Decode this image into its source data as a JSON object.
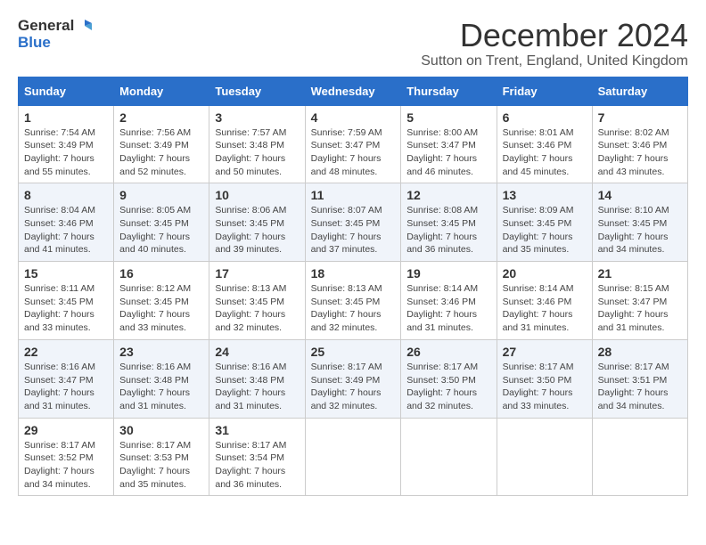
{
  "logo": {
    "general": "General",
    "blue": "Blue"
  },
  "title": "December 2024",
  "location": "Sutton on Trent, England, United Kingdom",
  "days_of_week": [
    "Sunday",
    "Monday",
    "Tuesday",
    "Wednesday",
    "Thursday",
    "Friday",
    "Saturday"
  ],
  "weeks": [
    [
      {
        "day": "1",
        "sunrise": "7:54 AM",
        "sunset": "3:49 PM",
        "daylight": "7 hours and 55 minutes."
      },
      {
        "day": "2",
        "sunrise": "7:56 AM",
        "sunset": "3:49 PM",
        "daylight": "7 hours and 52 minutes."
      },
      {
        "day": "3",
        "sunrise": "7:57 AM",
        "sunset": "3:48 PM",
        "daylight": "7 hours and 50 minutes."
      },
      {
        "day": "4",
        "sunrise": "7:59 AM",
        "sunset": "3:47 PM",
        "daylight": "7 hours and 48 minutes."
      },
      {
        "day": "5",
        "sunrise": "8:00 AM",
        "sunset": "3:47 PM",
        "daylight": "7 hours and 46 minutes."
      },
      {
        "day": "6",
        "sunrise": "8:01 AM",
        "sunset": "3:46 PM",
        "daylight": "7 hours and 45 minutes."
      },
      {
        "day": "7",
        "sunrise": "8:02 AM",
        "sunset": "3:46 PM",
        "daylight": "7 hours and 43 minutes."
      }
    ],
    [
      {
        "day": "8",
        "sunrise": "8:04 AM",
        "sunset": "3:46 PM",
        "daylight": "7 hours and 41 minutes."
      },
      {
        "day": "9",
        "sunrise": "8:05 AM",
        "sunset": "3:45 PM",
        "daylight": "7 hours and 40 minutes."
      },
      {
        "day": "10",
        "sunrise": "8:06 AM",
        "sunset": "3:45 PM",
        "daylight": "7 hours and 39 minutes."
      },
      {
        "day": "11",
        "sunrise": "8:07 AM",
        "sunset": "3:45 PM",
        "daylight": "7 hours and 37 minutes."
      },
      {
        "day": "12",
        "sunrise": "8:08 AM",
        "sunset": "3:45 PM",
        "daylight": "7 hours and 36 minutes."
      },
      {
        "day": "13",
        "sunrise": "8:09 AM",
        "sunset": "3:45 PM",
        "daylight": "7 hours and 35 minutes."
      },
      {
        "day": "14",
        "sunrise": "8:10 AM",
        "sunset": "3:45 PM",
        "daylight": "7 hours and 34 minutes."
      }
    ],
    [
      {
        "day": "15",
        "sunrise": "8:11 AM",
        "sunset": "3:45 PM",
        "daylight": "7 hours and 33 minutes."
      },
      {
        "day": "16",
        "sunrise": "8:12 AM",
        "sunset": "3:45 PM",
        "daylight": "7 hours and 33 minutes."
      },
      {
        "day": "17",
        "sunrise": "8:13 AM",
        "sunset": "3:45 PM",
        "daylight": "7 hours and 32 minutes."
      },
      {
        "day": "18",
        "sunrise": "8:13 AM",
        "sunset": "3:45 PM",
        "daylight": "7 hours and 32 minutes."
      },
      {
        "day": "19",
        "sunrise": "8:14 AM",
        "sunset": "3:46 PM",
        "daylight": "7 hours and 31 minutes."
      },
      {
        "day": "20",
        "sunrise": "8:14 AM",
        "sunset": "3:46 PM",
        "daylight": "7 hours and 31 minutes."
      },
      {
        "day": "21",
        "sunrise": "8:15 AM",
        "sunset": "3:47 PM",
        "daylight": "7 hours and 31 minutes."
      }
    ],
    [
      {
        "day": "22",
        "sunrise": "8:16 AM",
        "sunset": "3:47 PM",
        "daylight": "7 hours and 31 minutes."
      },
      {
        "day": "23",
        "sunrise": "8:16 AM",
        "sunset": "3:48 PM",
        "daylight": "7 hours and 31 minutes."
      },
      {
        "day": "24",
        "sunrise": "8:16 AM",
        "sunset": "3:48 PM",
        "daylight": "7 hours and 31 minutes."
      },
      {
        "day": "25",
        "sunrise": "8:17 AM",
        "sunset": "3:49 PM",
        "daylight": "7 hours and 32 minutes."
      },
      {
        "day": "26",
        "sunrise": "8:17 AM",
        "sunset": "3:50 PM",
        "daylight": "7 hours and 32 minutes."
      },
      {
        "day": "27",
        "sunrise": "8:17 AM",
        "sunset": "3:50 PM",
        "daylight": "7 hours and 33 minutes."
      },
      {
        "day": "28",
        "sunrise": "8:17 AM",
        "sunset": "3:51 PM",
        "daylight": "7 hours and 34 minutes."
      }
    ],
    [
      {
        "day": "29",
        "sunrise": "8:17 AM",
        "sunset": "3:52 PM",
        "daylight": "7 hours and 34 minutes."
      },
      {
        "day": "30",
        "sunrise": "8:17 AM",
        "sunset": "3:53 PM",
        "daylight": "7 hours and 35 minutes."
      },
      {
        "day": "31",
        "sunrise": "8:17 AM",
        "sunset": "3:54 PM",
        "daylight": "7 hours and 36 minutes."
      },
      null,
      null,
      null,
      null
    ]
  ]
}
